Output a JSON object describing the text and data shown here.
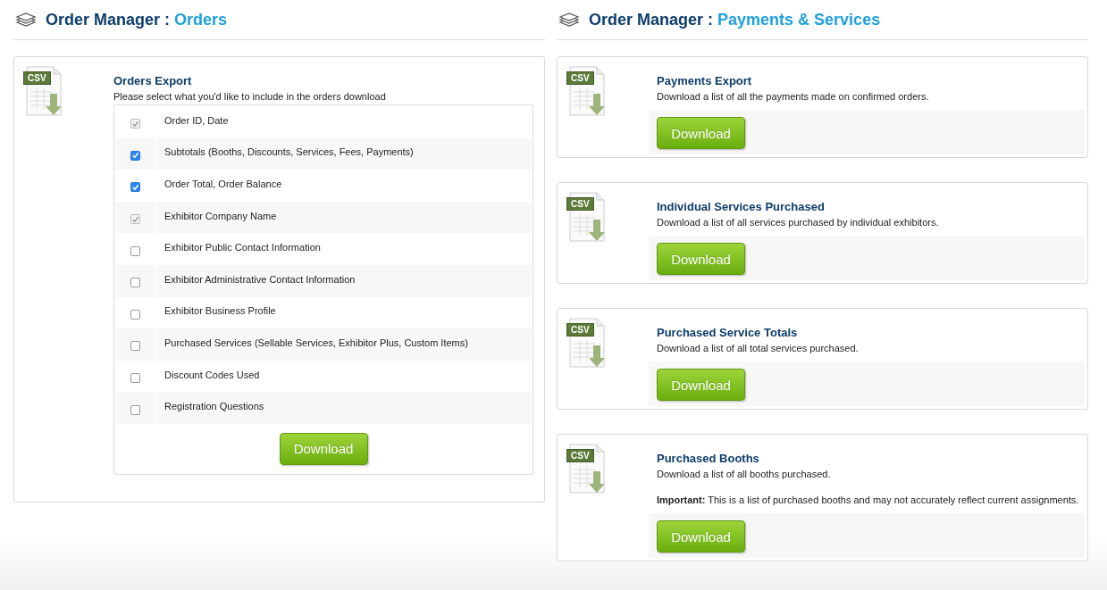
{
  "orders_panel": {
    "heading": {
      "prefix": "Order Manager :",
      "section": "Orders"
    },
    "card": {
      "file_badge": "CSV",
      "title": "Orders Export",
      "description": "Please select what you'd like to include in the orders download",
      "options": [
        {
          "label": "Order ID, Date",
          "checked": true,
          "disabled": true
        },
        {
          "label": "Subtotals (Booths, Discounts, Services, Fees, Payments)",
          "checked": true,
          "disabled": false
        },
        {
          "label": "Order Total, Order Balance",
          "checked": true,
          "disabled": false
        },
        {
          "label": "Exhibitor Company Name",
          "checked": true,
          "disabled": true
        },
        {
          "label": "Exhibitor Public Contact Information",
          "checked": false,
          "disabled": false
        },
        {
          "label": "Exhibitor Administrative Contact Information",
          "checked": false,
          "disabled": false
        },
        {
          "label": "Exhibitor Business Profile",
          "checked": false,
          "disabled": false
        },
        {
          "label": "Purchased Services (Sellable Services, Exhibitor Plus, Custom Items)",
          "checked": false,
          "disabled": false
        },
        {
          "label": "Discount Codes Used",
          "checked": false,
          "disabled": false
        },
        {
          "label": "Registration Questions",
          "checked": false,
          "disabled": false
        }
      ],
      "button": "Download"
    }
  },
  "payments_panel": {
    "heading": {
      "prefix": "Order Manager :",
      "section": "Payments & Services"
    },
    "cards": [
      {
        "file_badge": "CSV",
        "title": "Payments Export",
        "description": "Download a list of all the payments made on confirmed orders.",
        "button": "Download"
      },
      {
        "file_badge": "CSV",
        "title": "Individual Services Purchased",
        "description": "Download a list of all services purchased by individual exhibitors.",
        "button": "Download"
      },
      {
        "file_badge": "CSV",
        "title": "Purchased Service Totals",
        "description": "Download a list of all total services purchased.",
        "button": "Download"
      },
      {
        "file_badge": "CSV",
        "title": "Purchased Booths",
        "description": "Download a list of all booths purchased.",
        "note": "**Important:** This is a list of purchased booths and may not accurately reflect current assignments.",
        "button": "Download"
      }
    ]
  }
}
